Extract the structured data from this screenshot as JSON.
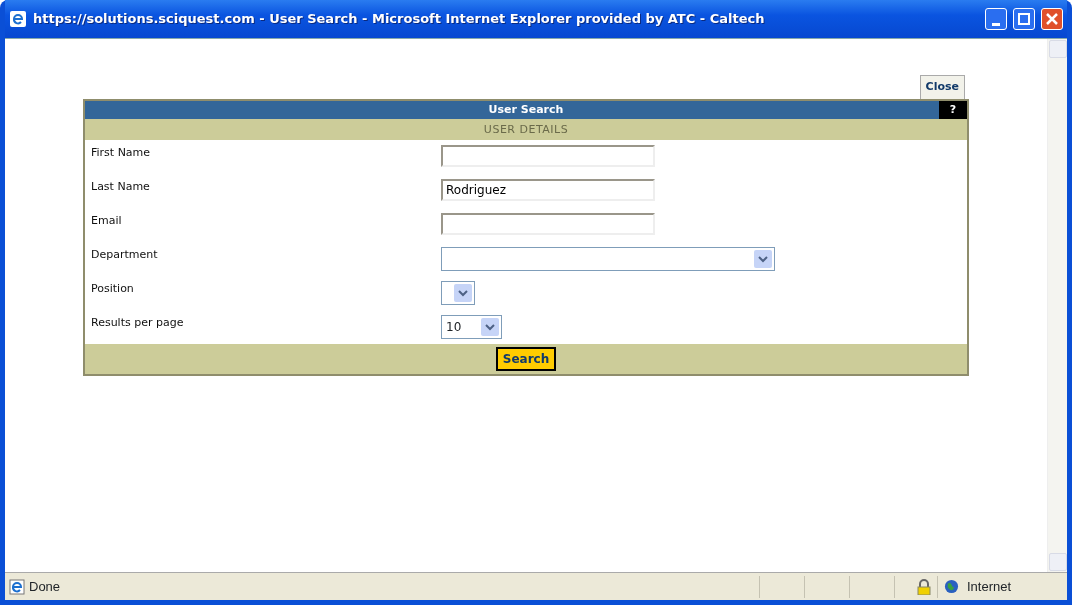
{
  "window": {
    "title": "https://solutions.sciquest.com - User Search - Microsoft Internet Explorer provided by ATC - Caltech"
  },
  "close_button": "Close",
  "panel": {
    "title": "User Search",
    "help": "?",
    "section": "USER DETAILS"
  },
  "fields": [
    {
      "label": "First Name",
      "kind": "text"
    },
    {
      "label": "Last Name",
      "kind": "text",
      "value": "Rodriguez"
    },
    {
      "label": "Email",
      "kind": "text"
    },
    {
      "label": "Department",
      "kind": "select"
    },
    {
      "label": "Position",
      "kind": "select"
    },
    {
      "label": "Results per page",
      "kind": "select",
      "value": "10"
    }
  ],
  "search_button": "Search",
  "status_bar": {
    "text": "Done",
    "zone": "Internet"
  }
}
